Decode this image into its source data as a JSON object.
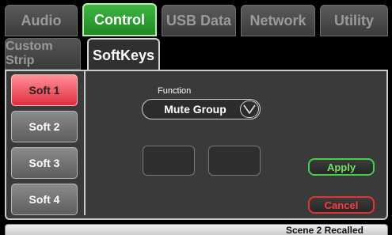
{
  "top_tabs": [
    "Audio",
    "Control",
    "USB Data",
    "Network",
    "Utility"
  ],
  "active_top_tab": "Control",
  "sub_tabs": [
    "Custom Strip",
    "SoftKeys"
  ],
  "active_sub_tab": "SoftKeys",
  "softkeys": [
    "Soft 1",
    "Soft 2",
    "Soft 3",
    "Soft 4"
  ],
  "selected_softkey": "Soft 1",
  "function": {
    "label": "Function",
    "value": "Mute Group"
  },
  "buttons": {
    "apply": "Apply",
    "cancel": "Cancel"
  },
  "status": "Scene 2 Recalled",
  "colors": {
    "active_tab": "#2fa035",
    "selected_softkey": "#f04a58",
    "apply": "#44d04a",
    "cancel": "#e23434"
  },
  "icons": {
    "dropdown": "chevron-down-icon"
  }
}
